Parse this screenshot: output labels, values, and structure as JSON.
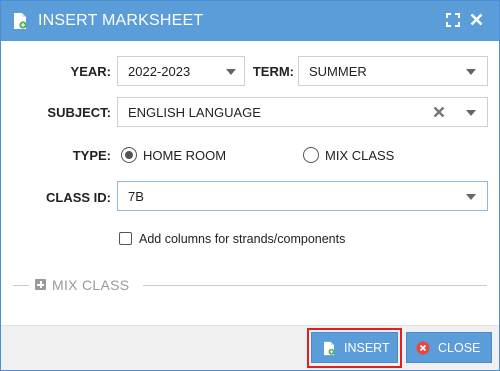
{
  "window": {
    "title": "INSERT MARKSHEET"
  },
  "form": {
    "year_label": "YEAR:",
    "year_value": "2022-2023",
    "term_label": "TERM:",
    "term_value": "SUMMER",
    "subject_label": "SUBJECT:",
    "subject_value": "ENGLISH LANGUAGE",
    "type_label": "TYPE:",
    "type_options": [
      "HOME ROOM",
      "MIX CLASS"
    ],
    "type_selected": "HOME ROOM",
    "class_label": "CLASS ID:",
    "class_value": "7B",
    "strands_checkbox_label": "Add columns for strands/components",
    "strands_checked": false
  },
  "mix_section": {
    "title": "MIX CLASS"
  },
  "footer": {
    "insert_label": "INSERT",
    "close_label": "CLOSE"
  },
  "colors": {
    "accent": "#5b9dd9",
    "highlight": "#e02020",
    "close_icon": "#e8453c"
  }
}
